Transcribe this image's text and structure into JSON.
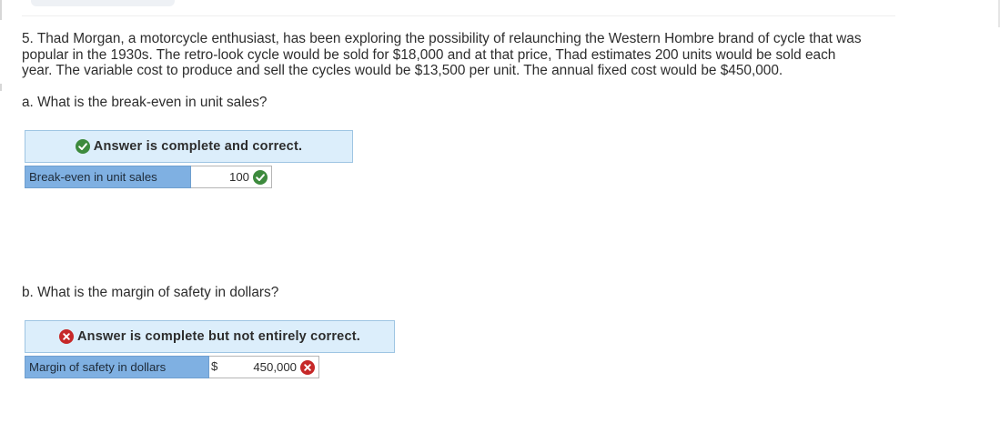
{
  "question": {
    "text": "5. Thad Morgan, a motorcycle enthusiast, has been exploring the possibility of relaunching the Western Hombre brand of cycle that was popular in the 1930s. The retro-look cycle would be sold for $18,000 and at that price, Thad estimates 200 units would be sold each year. The variable cost to produce and sell the cycles would be $13,500 per unit. The annual fixed cost would be $450,000."
  },
  "part_a": {
    "prompt": "a. What is the break-even in unit sales?",
    "banner": "Answer is complete and correct.",
    "status_icon": "check-circle-icon",
    "row_label": "Break-even in unit sales",
    "value": "100"
  },
  "part_b": {
    "prompt": "b. What is the margin of safety in dollars?",
    "banner": "Answer is complete but not entirely correct.",
    "status_icon": "x-circle-icon",
    "row_label": "Margin of safety in dollars",
    "currency": "$",
    "value": "450,000"
  },
  "colors": {
    "banner_bg": "#dceefb",
    "label_bg": "#7fb0e2",
    "correct": "#3d8a3d",
    "incorrect": "#c62828"
  }
}
